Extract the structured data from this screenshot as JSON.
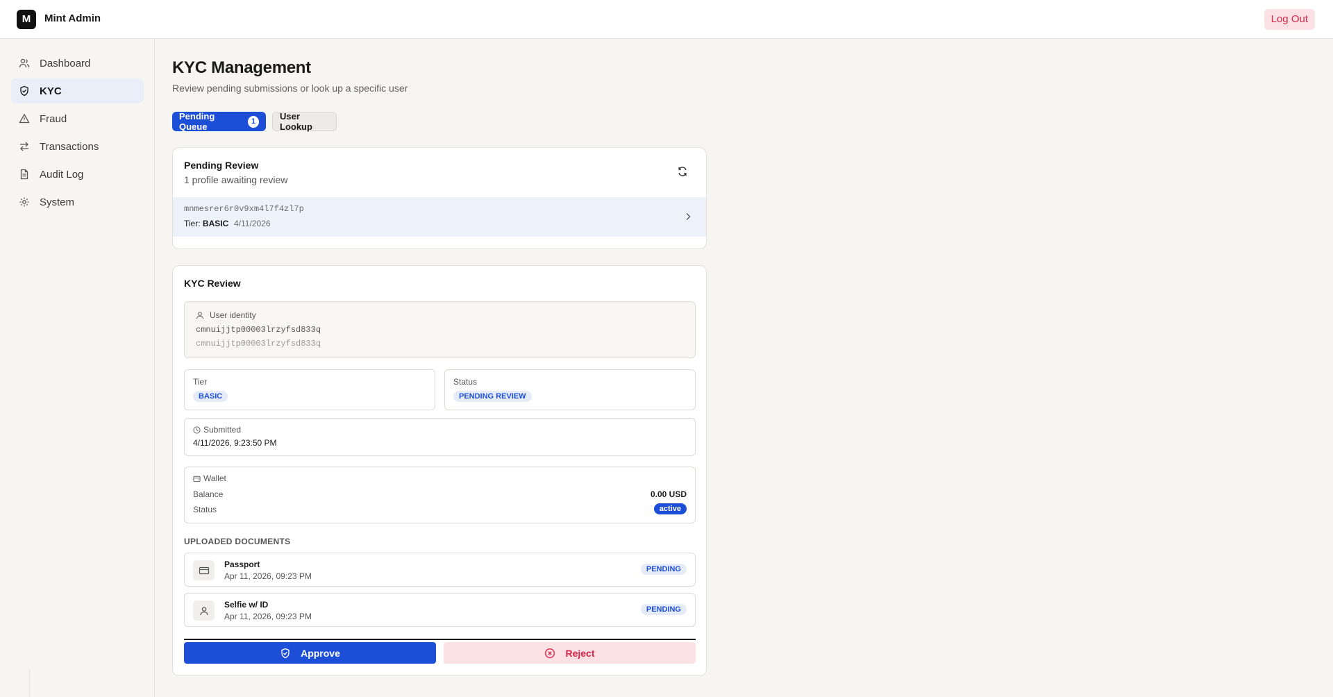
{
  "header": {
    "logo_letter": "M",
    "app_name": "Mint Admin",
    "logout_label": "Log Out"
  },
  "sidebar": {
    "items": [
      {
        "label": "Dashboard",
        "icon": "users-icon",
        "active": false
      },
      {
        "label": "KYC",
        "icon": "shield-check-icon",
        "active": true
      },
      {
        "label": "Fraud",
        "icon": "warning-icon",
        "active": false
      },
      {
        "label": "Transactions",
        "icon": "arrows-exchange-icon",
        "active": false
      },
      {
        "label": "Audit Log",
        "icon": "document-icon",
        "active": false
      },
      {
        "label": "System",
        "icon": "gear-icon",
        "active": false
      }
    ]
  },
  "page": {
    "title": "KYC Management",
    "subtitle": "Review pending submissions or look up a specific user"
  },
  "tabs": {
    "pending_label": "Pending Queue",
    "pending_count": "1",
    "lookup_label": "User Lookup"
  },
  "pending": {
    "title": "Pending Review",
    "subtitle": "1 profile awaiting review",
    "rows": [
      {
        "id": "mnmesrer6r0v9xm4l7f4zl7p",
        "tier_label": "Tier:",
        "tier": "BASIC",
        "date": "4/11/2026"
      }
    ]
  },
  "review": {
    "title": "KYC Review",
    "identity_label": "User identity",
    "identity_primary": "cmnuijjtp00003lrzyfsd833q",
    "identity_secondary": "cmnuijjtp00003lrzyfsd833q",
    "tier_label": "Tier",
    "tier_value": "BASIC",
    "status_label": "Status",
    "status_value": "PENDING REVIEW",
    "submitted_label": "Submitted",
    "submitted_value": "4/11/2026, 9:23:50 PM",
    "wallet_label": "Wallet",
    "balance_label": "Balance",
    "balance_value": "0.00 USD",
    "wallet_status_label": "Status",
    "wallet_status_value": "active",
    "documents_title": "UPLOADED DOCUMENTS",
    "documents": [
      {
        "name": "Passport",
        "date": "Apr 11, 2026, 09:23 PM",
        "status": "PENDING",
        "icon": "id-card-icon"
      },
      {
        "name": "Selfie w/ ID",
        "date": "Apr 11, 2026, 09:23 PM",
        "status": "PENDING",
        "icon": "user-icon"
      }
    ],
    "approve_label": "Approve",
    "reject_label": "Reject"
  },
  "colors": {
    "accent": "#1d4ed8",
    "danger": "#d8264a",
    "danger_bg": "#fbe1e4",
    "active_nav_bg": "#eaeef8"
  }
}
